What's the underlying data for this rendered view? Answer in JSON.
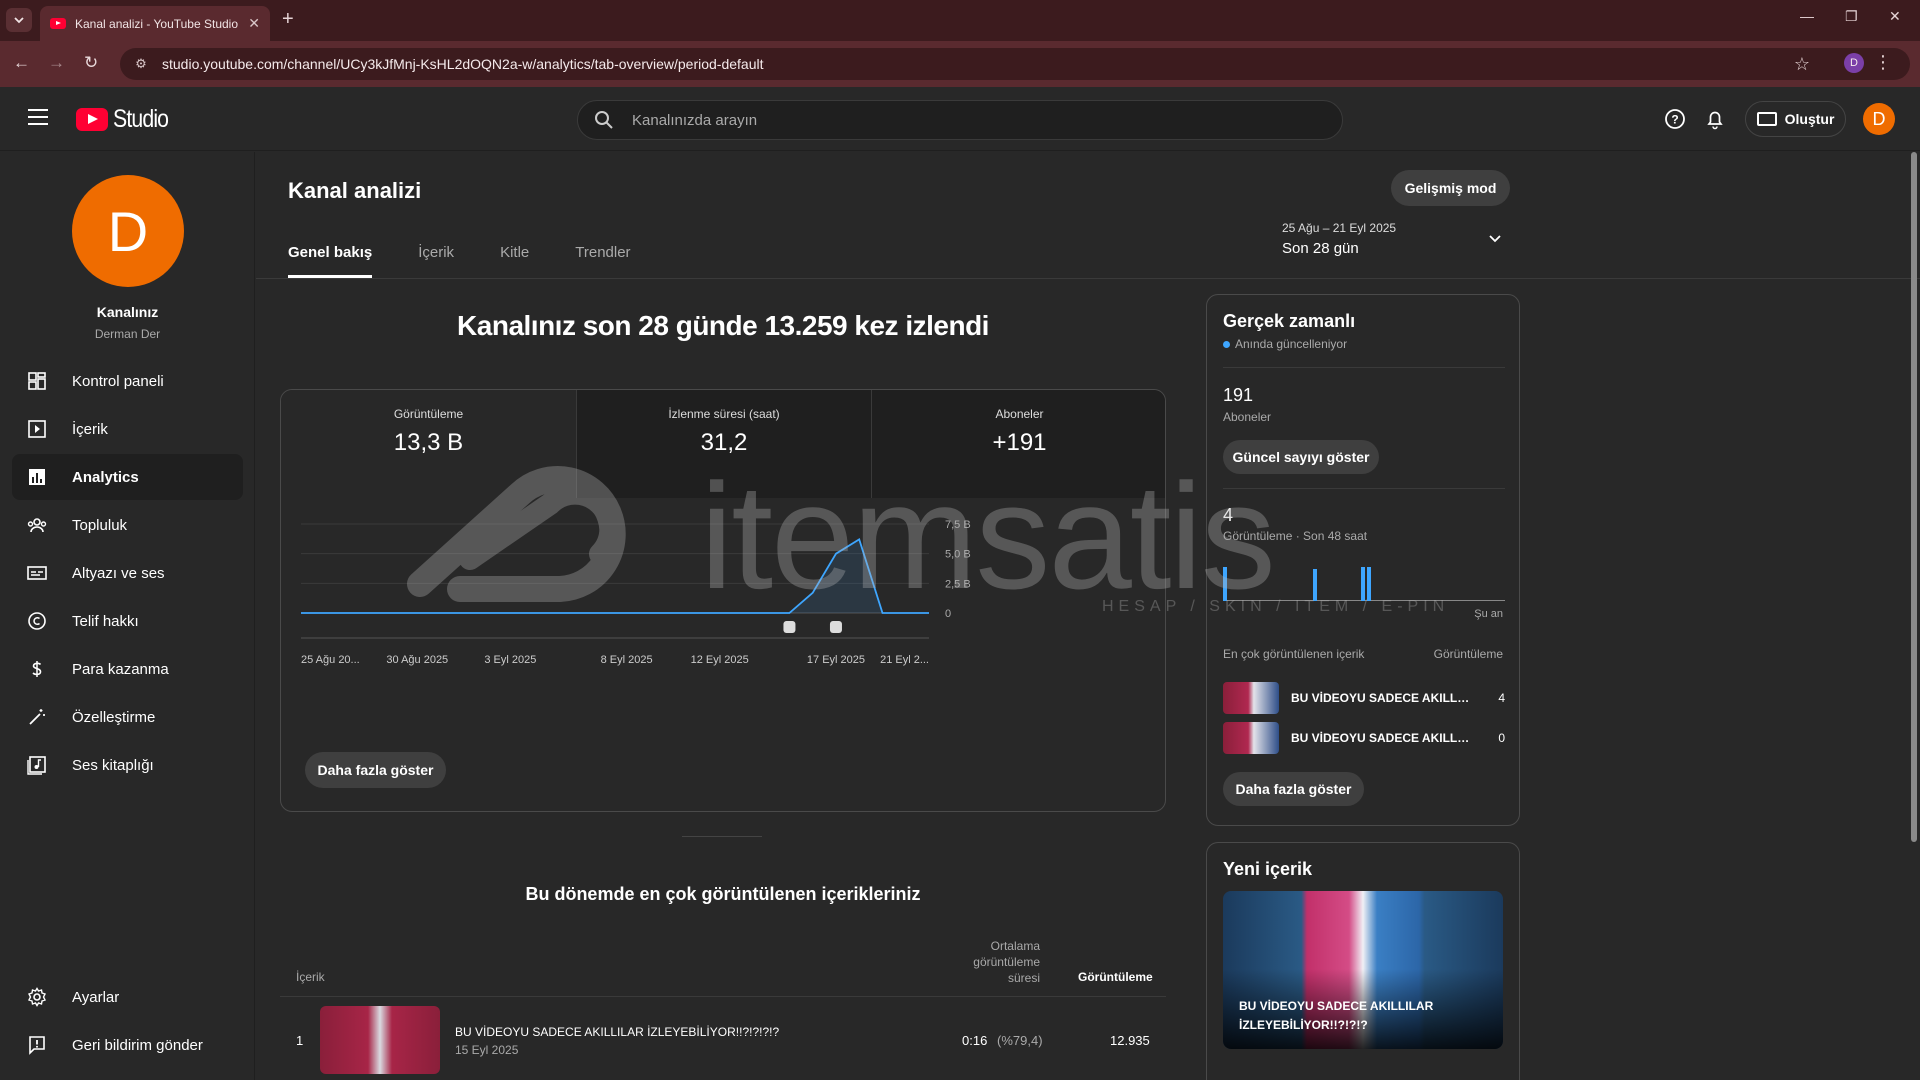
{
  "browser": {
    "tab_title": "Kanal analizi - YouTube Studio",
    "url": "studio.youtube.com/channel/UCy3kJfMnj-KsHL2dOQN2a-w/analytics/tab-overview/period-default",
    "profile_initial": "D"
  },
  "header": {
    "logo_text": "Studio",
    "search_placeholder": "Kanalınızda arayın",
    "create_label": "Oluştur",
    "avatar_initial": "D"
  },
  "sidebar": {
    "avatar_initial": "D",
    "channel_title": "Kanalınız",
    "channel_name": "Derman Der",
    "items": [
      {
        "label": "Kontrol paneli",
        "icon": "dashboard-icon"
      },
      {
        "label": "İçerik",
        "icon": "content-icon"
      },
      {
        "label": "Analytics",
        "icon": "analytics-icon",
        "active": true
      },
      {
        "label": "Topluluk",
        "icon": "community-icon"
      },
      {
        "label": "Altyazı ve ses",
        "icon": "subtitles-icon"
      },
      {
        "label": "Telif hakkı",
        "icon": "copyright-icon"
      },
      {
        "label": "Para kazanma",
        "icon": "dollar-icon"
      },
      {
        "label": "Özelleştirme",
        "icon": "magic-wand-icon"
      },
      {
        "label": "Ses kitaplığı",
        "icon": "audio-library-icon"
      }
    ],
    "footer": [
      {
        "label": "Ayarlar",
        "icon": "settings-icon"
      },
      {
        "label": "Geri bildirim gönder",
        "icon": "feedback-icon"
      }
    ]
  },
  "main": {
    "title": "Kanal analizi",
    "advanced_mode": "Gelişmiş mod",
    "tabs": [
      "Genel bakış",
      "İçerik",
      "Kitle",
      "Trendler"
    ],
    "date_range": "25 Ağu – 21 Eyl 2025",
    "date_label": "Son 28 gün",
    "headline": "Kanalınız son 28 günde 13.259 kez izlendi",
    "metrics": [
      {
        "label": "Görüntüleme",
        "value": "13,3 B"
      },
      {
        "label": "İzlenme süresi (saat)",
        "value": "31,2"
      },
      {
        "label": "Aboneler",
        "value": "+191"
      }
    ],
    "more_button": "Daha fazla göster"
  },
  "chart_data": {
    "type": "line",
    "x": [
      "25 Ağu",
      "26 Ağu",
      "27 Ağu",
      "28 Ağu",
      "29 Ağu",
      "30 Ağu",
      "31 Ağu",
      "1 Eyl",
      "2 Eyl",
      "3 Eyl",
      "4 Eyl",
      "5 Eyl",
      "6 Eyl",
      "7 Eyl",
      "8 Eyl",
      "9 Eyl",
      "10 Eyl",
      "11 Eyl",
      "12 Eyl",
      "13 Eyl",
      "14 Eyl",
      "15 Eyl",
      "16 Eyl",
      "17 Eyl",
      "18 Eyl",
      "19 Eyl",
      "20 Eyl",
      "21 Eyl"
    ],
    "series": [
      {
        "values": [
          0,
          0,
          0,
          0,
          0,
          0,
          0,
          0,
          0,
          0,
          0,
          0,
          0,
          0,
          0,
          0,
          0,
          0,
          0,
          0,
          0,
          0,
          1700,
          5000,
          6200,
          0,
          0,
          0
        ]
      }
    ],
    "x_tick_labels": [
      "25 Ağu 20...",
      "30 Ağu 2025",
      "3 Eyl 2025",
      "8 Eyl 2025",
      "12 Eyl 2025",
      "17 Eyl 2025",
      "21 Eyl 2..."
    ],
    "x_tick_index": [
      0,
      5,
      9,
      14,
      18,
      23,
      27
    ],
    "y_ticks": [
      "0",
      "2,5 B",
      "5,0 B",
      "7,5 B"
    ],
    "y_tick_values": [
      0,
      2500,
      5000,
      7500
    ],
    "ylim": [
      0,
      7500
    ],
    "marker_index": [
      21,
      23
    ],
    "line_color": "#3ea6ff"
  },
  "top_content": {
    "title": "Bu dönemde en çok görüntülenen içerikleriniz",
    "col_content": "İçerik",
    "col_avg": "Ortalama görüntüleme süresi",
    "col_views": "Görüntüleme",
    "rows": [
      {
        "rank": "1",
        "title": "BU VİDEOYU SADECE AKILLILAR İZLEYEBİLİYOR!!?!?!?!?",
        "date": "15 Eyl 2025",
        "avg": "0:16",
        "avg_pct": "(%79,4)",
        "views": "12.935"
      }
    ]
  },
  "realtime": {
    "title": "Gerçek zamanlı",
    "live_text": "Anında güncelleniyor",
    "subs_value": "191",
    "subs_label": "Aboneler",
    "show_count_btn": "Güncel sayıyı göster",
    "views_value": "4",
    "views_label": "Görüntüleme · Son 48 saat",
    "now_label": "Şu an",
    "bars": [
      1.0,
      0.95,
      1.0,
      1.0
    ],
    "col_content": "En çok görüntülenen içerik",
    "col_views": "Görüntüleme",
    "rows": [
      {
        "title": "BU VİDEOYU SADECE AKILLILAR İZLEYEBİLİYOR!!?!?!?!?",
        "count": "4"
      },
      {
        "title": "BU VİDEOYU SADECE AKILLILAR İZLEYEBİLİYOR!!?!?!?!?",
        "count": "0"
      }
    ],
    "more_button": "Daha fazla göster"
  },
  "new_content": {
    "title": "Yeni içerik",
    "video_title": "BU VİDEOYU SADECE AKILLILAR İZLEYEBİLİYOR!!?!?!?"
  },
  "watermark": {
    "text": "itemsatis",
    "sub": "HESAP / SKIN / ITEM / E-PIN"
  }
}
